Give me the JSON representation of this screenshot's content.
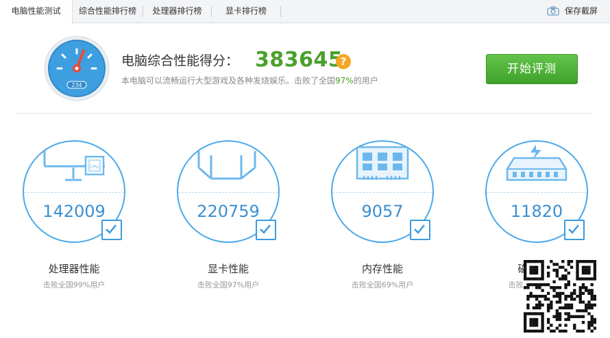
{
  "tabs": [
    {
      "label": "电脑性能测试",
      "active": true
    },
    {
      "label": "综合性能排行榜",
      "active": false
    },
    {
      "label": "处理器排行榜",
      "active": false
    },
    {
      "label": "显卡排行榜",
      "active": false
    }
  ],
  "toolbar": {
    "save_label": "保存截屏",
    "save_icon": "camera-icon"
  },
  "gauge": {
    "odometer": "234",
    "icon": "speedometer-icon"
  },
  "score": {
    "title": "电脑综合性能得分：",
    "value": "383645",
    "help_glyph": "?",
    "desc_prefix": "本电脑可以流畅运行大型游戏及各种发烧娱乐。击败了全国",
    "desc_percent": "97%",
    "desc_suffix": "的用户"
  },
  "start_button": {
    "label": "开始评测"
  },
  "cards": [
    {
      "icon": "monitor-cpu-icon",
      "score": "142009",
      "label": "处理器性能",
      "rank": "击败全国99%用户",
      "cpu_chip_text": "CPU"
    },
    {
      "icon": "gpu-cube-icon",
      "score": "220759",
      "label": "显卡性能",
      "rank": "击败全国97%用户"
    },
    {
      "icon": "memory-chip-icon",
      "score": "9057",
      "label": "内存性能",
      "rank": "击败全国69%用户"
    },
    {
      "icon": "disk-drive-icon",
      "score": "11820",
      "label": "磁",
      "rank": "击败全"
    }
  ],
  "colors": {
    "accent_blue": "#4aa8e8",
    "score_green": "#4aa02c",
    "button_green": "#4fb43a",
    "help_orange": "#f5a623"
  }
}
